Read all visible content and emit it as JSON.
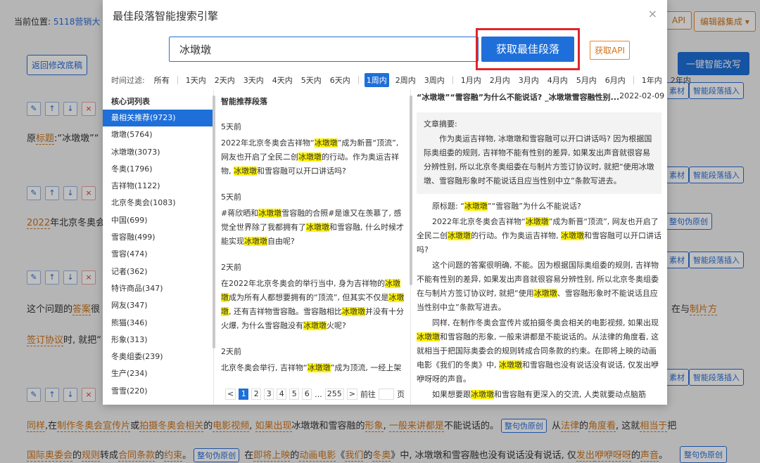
{
  "background": {
    "breadcrumb_label": "当前位置:",
    "breadcrumb_link": "5118营销大",
    "api_right": "API",
    "editor_btn": "编辑器集成",
    "back_btn": "返回修改底稿",
    "rewrite_btn": "一键智能改写",
    "material": "素材",
    "smart_insert": "智能段落插入",
    "sentence_orig": "整句伪原创",
    "line1_a": "原",
    "line1_b": "标题",
    "line1_c": ":“冰墩墩”“",
    "line2_a": "2022",
    "line2_b": "年北京冬奥会",
    "line3_a": "这个问题的",
    "line3_b": "答案",
    "line3_c": "很",
    "line3_d": "在与",
    "line3_e": "制片方",
    "line4_a": "签订协议",
    "line4_b": "时, 就把“",
    "line5": [
      "同样",
      ",在",
      "制作冬奥会宣传片",
      "或",
      "拍摄冬奥会相关",
      "的",
      "电影视频",
      ", ",
      "如果出现",
      "冰墩墩和雪容融的",
      "形象",
      ", ",
      "一般来讲都是",
      "不能说话的。"
    ],
    "line5_tail_a": "从",
    "line5_tail_b": "法律",
    "line5_tail_c": "的",
    "line5_tail_d": "角度看",
    "line5_tail_e": ", 这就",
    "line5_tail_f": "相当于",
    "line5_tail_g": "把",
    "line6": [
      "国际奥委会",
      "的",
      "规则",
      "转成",
      "合同条款",
      "的",
      "约束",
      "。"
    ],
    "line6_mid_a": "在",
    "line6_mid_b": "即将上映",
    "line6_mid_c": "的",
    "line6_mid_d": "动画电影",
    "line6_mid_e": "《",
    "line6_mid_f": "我们",
    "line6_mid_g": "的",
    "line6_mid_h": "冬奥",
    "line6_mid_i": "》中, 冰墩墩和雪容融也没有说话没有说话, 仅",
    "line6_mid_j": "发出",
    "line6_mid_k": "咿咿呀呀",
    "line6_mid_l": "的",
    "line6_mid_m": "声音",
    "line6_mid_n": "。"
  },
  "modal": {
    "title": "最佳段落智能搜索引擎",
    "close": "×",
    "search_value": "冰墩墩",
    "search_btn": "获取最佳段落",
    "api_btn": "获取API",
    "filter_label": "时间过滤:",
    "filters_group1": [
      "所有"
    ],
    "filters_group2": [
      "1天内",
      "2天内",
      "3天内",
      "4天内",
      "5天内",
      "6天内"
    ],
    "filters_group3": [
      "1周内",
      "2周内",
      "3周内"
    ],
    "filters_group4": [
      "1月内",
      "2月内",
      "3月内",
      "4月内",
      "5月内",
      "6月内"
    ],
    "filters_group5": [
      "1年内",
      "2年内"
    ],
    "active_filter": "1周内",
    "col_keywords": "核心词列表",
    "col_recommend": "智能推荐段落",
    "keywords": [
      "最相关推荐(9723)",
      "墩墩(5764)",
      "冰墩墩(3073)",
      "冬奥(1796)",
      "吉祥物(1122)",
      "北京冬奥会(1083)",
      "中国(699)",
      "雪容融(499)",
      "雪容(474)",
      "记者(362)",
      "特许商品(347)",
      "网友(347)",
      "熊猫(346)",
      "形象(313)",
      "冬奥组委(239)",
      "生产(234)",
      "雪雪(220)"
    ],
    "results": [
      {
        "time": "5天前",
        "segments": [
          {
            "t": "2022年北京冬奥会吉祥物“",
            "h": false
          },
          {
            "t": "冰墩墩",
            "h": true
          },
          {
            "t": "”成为新晋“顶流”, 网友也开启了全民二创",
            "h": false
          },
          {
            "t": "冰墩墩",
            "h": true
          },
          {
            "t": "的行动。作为奥运吉祥物, ",
            "h": false
          },
          {
            "t": "冰墩墩",
            "h": true
          },
          {
            "t": "和雪容融可以开口讲话吗?",
            "h": false
          }
        ]
      },
      {
        "time": "5天前",
        "segments": [
          {
            "t": "#蒋欣晒和",
            "h": false
          },
          {
            "t": "冰墩墩",
            "h": true
          },
          {
            "t": "雪容融的合照#是谁又在羡慕了, 感觉全世界除了我都拥有了",
            "h": false
          },
          {
            "t": "冰墩墩",
            "h": true
          },
          {
            "t": "和雪容融, 什么时候才能实现",
            "h": false
          },
          {
            "t": "冰墩墩",
            "h": true
          },
          {
            "t": "自由呢?",
            "h": false
          }
        ]
      },
      {
        "time": "2天前",
        "segments": [
          {
            "t": "在2022年北京冬奥会的举行当中, 身为吉祥物的",
            "h": false
          },
          {
            "t": "冰墩墩",
            "h": true
          },
          {
            "t": "成为所有人都想要拥有的“顶流”, 但其实不仅是",
            "h": false
          },
          {
            "t": "冰墩墩",
            "h": true
          },
          {
            "t": ", 还有吉祥物雪容融。雪容融相比",
            "h": false
          },
          {
            "t": "冰墩墩",
            "h": true
          },
          {
            "t": "并没有十分火爆, 为什么雪容融没有",
            "h": false
          },
          {
            "t": "冰墩墩",
            "h": true
          },
          {
            "t": "火呢?",
            "h": false
          }
        ]
      },
      {
        "time": "2天前",
        "segments": [
          {
            "t": "北京冬奥会举行, 吉祥物“",
            "h": false
          },
          {
            "t": "冰墩墩",
            "h": true
          },
          {
            "t": "”成为顶流, 一经上架",
            "h": false
          }
        ]
      }
    ],
    "pager": {
      "prev": "<",
      "pages": [
        "1",
        "2",
        "3",
        "4",
        "5",
        "6"
      ],
      "ellipsis": "...",
      "last": "255",
      "next": ">",
      "goto": "前往",
      "page_unit": "页"
    },
    "article": {
      "title": "“冰墩墩”“雪容融”为什么不能说话? _冰墩墩雪容融性别...",
      "date": "2022-02-09",
      "abstract_label": "文章摘要:",
      "abstract": "作为奥运吉祥物, 冰墩墩和雪容融可以开口讲话吗? 因为根据国际奥组委的规则, 吉祥物不能有性别的差异, 如果发出声音就很容易分辨性别, 所以北京冬奥组委在与制片方签订协议时, 就把“使用冰墩墩、雪容融形象时不能说话且应当性别中立”条款写进去。",
      "paragraphs": [
        [
          {
            "t": "原标题: “",
            "h": false
          },
          {
            "t": "冰墩墩",
            "h": true
          },
          {
            "t": "”“雪容融”为什么不能说话?",
            "h": false
          }
        ],
        [
          {
            "t": "2022年北京冬奥会吉祥物“",
            "h": false
          },
          {
            "t": "冰墩墩",
            "h": true
          },
          {
            "t": "”成为新晋“顶流”, 网友也开启了全民二创",
            "h": false
          },
          {
            "t": "冰墩墩",
            "h": true
          },
          {
            "t": "的行动。作为奥运吉祥物, ",
            "h": false
          },
          {
            "t": "冰墩墩",
            "h": true
          },
          {
            "t": "和雪容融可以开口讲话吗?",
            "h": false
          }
        ],
        [
          {
            "t": "这个问题的答案很明确, 不能。因为根据国际奥组委的规则, 吉祥物不能有性别的差异, 如果发出声音就很容易分辨性别, 所以北京冬奥组委在与制片方签订协议时, 就把“使用",
            "h": false
          },
          {
            "t": "冰墩墩",
            "h": true
          },
          {
            "t": "、雪容融形象时不能说话且应当性别中立”条款写进去。",
            "h": false
          }
        ],
        [
          {
            "t": "同样, 在制作冬奥会宣传片或拍摄冬奥会相关的电影视频, 如果出现",
            "h": false
          },
          {
            "t": "冰墩墩",
            "h": true
          },
          {
            "t": "和雪容融的形象, 一般来讲都是不能说话的。从法律的角度看, 这就相当于把国际奥委会的规则转成合同条款的约束。在即将上映的动画电影《我们的冬奥》中, ",
            "h": false
          },
          {
            "t": "冰墩墩",
            "h": true
          },
          {
            "t": "和雪容融也没有说话没有说话, 仅发出咿咿呀呀的声音。",
            "h": false
          }
        ],
        [
          {
            "t": "如果想要跟",
            "h": false
          },
          {
            "t": "冰墩墩",
            "h": true
          },
          {
            "t": "和雪容融有更深入的交流, 人类就要动点脑筋",
            "h": false
          }
        ]
      ]
    }
  }
}
